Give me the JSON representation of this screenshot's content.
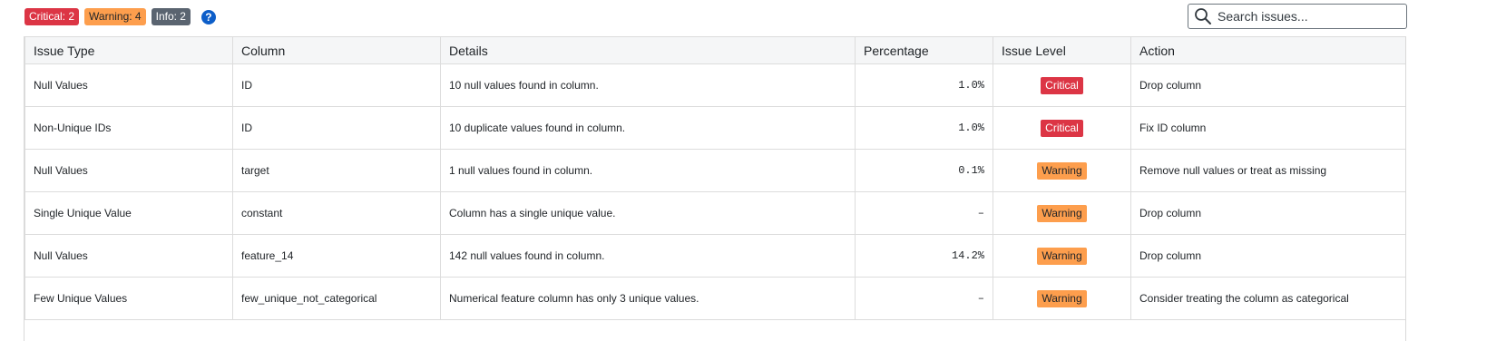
{
  "summary": {
    "critical_label": "Critical: 2",
    "warning_label": "Warning: 4",
    "info_label": "Info: 2",
    "help_icon": "question-circle-icon",
    "help_glyph": "?"
  },
  "search": {
    "placeholder": "Search issues...",
    "value": "",
    "icon": "magnifier-icon"
  },
  "colors": {
    "critical": "#dc3545",
    "warning": "#fd9e4d",
    "info": "#5a6470",
    "help": "#0d5ec9"
  },
  "table": {
    "headers": {
      "issue_type": "Issue Type",
      "column": "Column",
      "details": "Details",
      "percentage": "Percentage",
      "issue_level": "Issue Level",
      "action": "Action"
    },
    "rows": [
      {
        "issue_type": "Null Values",
        "column": "ID",
        "details": "10 null values found in column.",
        "percentage": "1.0%",
        "level": "Critical",
        "action": "Drop column"
      },
      {
        "issue_type": "Non-Unique IDs",
        "column": "ID",
        "details": "10 duplicate values found in column.",
        "percentage": "1.0%",
        "level": "Critical",
        "action": "Fix ID column"
      },
      {
        "issue_type": "Null Values",
        "column": "target",
        "details": "1 null values found in column.",
        "percentage": "0.1%",
        "level": "Warning",
        "action": "Remove null values or treat as missing"
      },
      {
        "issue_type": "Single Unique Value",
        "column": "constant",
        "details": "Column has a single unique value.",
        "percentage": "–",
        "level": "Warning",
        "action": "Drop column"
      },
      {
        "issue_type": "Null Values",
        "column": "feature_14",
        "details": "142 null values found in column.",
        "percentage": "14.2%",
        "level": "Warning",
        "action": "Drop column"
      },
      {
        "issue_type": "Few Unique Values",
        "column": "few_unique_not_categorical",
        "details": "Numerical feature column has only 3 unique values.",
        "percentage": "–",
        "level": "Warning",
        "action": "Consider treating the column as categorical"
      }
    ]
  }
}
